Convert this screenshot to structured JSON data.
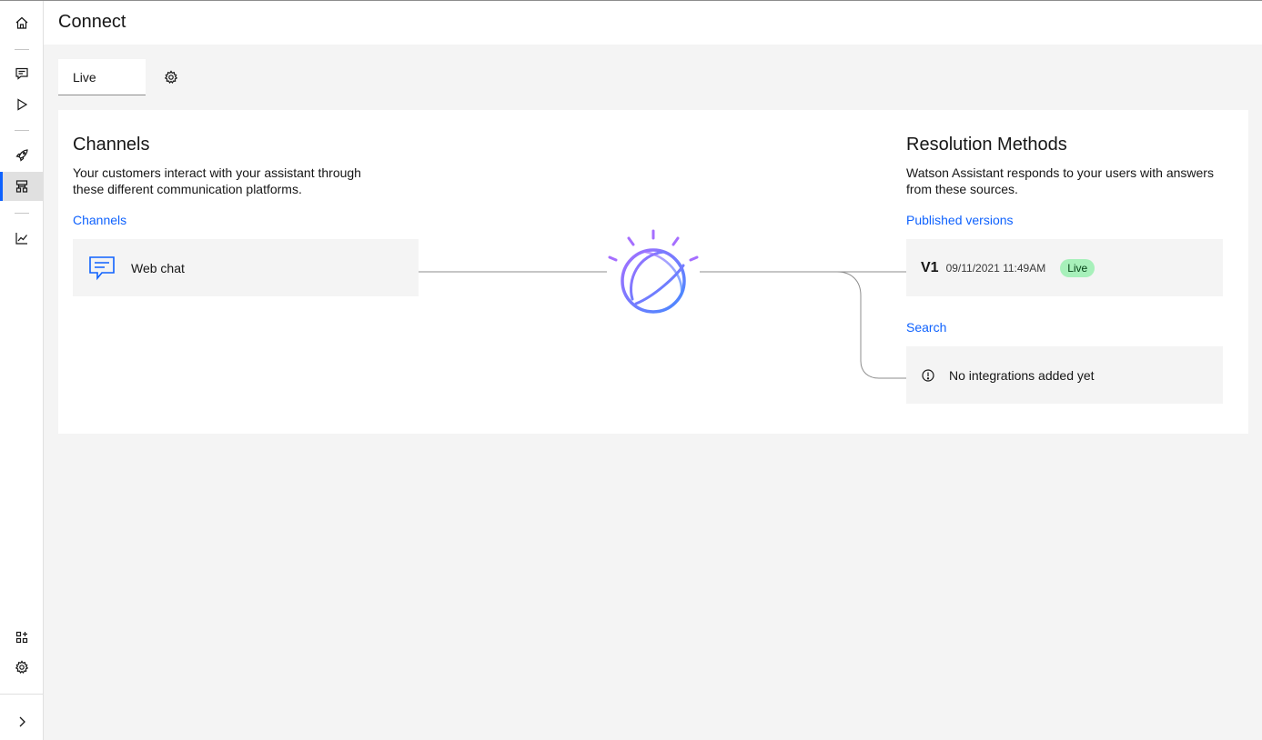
{
  "sidebar": {
    "items": [
      {
        "name": "home-icon"
      },
      {
        "name": "chat-icon"
      },
      {
        "name": "play-icon"
      },
      {
        "name": "rocket-icon"
      },
      {
        "name": "flow-icon",
        "active": true
      },
      {
        "name": "chart-icon"
      },
      {
        "name": "apps-icon"
      },
      {
        "name": "settings-icon"
      },
      {
        "name": "chevron-right-icon"
      }
    ]
  },
  "header": {
    "title": "Connect"
  },
  "environment": {
    "tab_label": "Live"
  },
  "channels": {
    "title": "Channels",
    "description_line1": "Your customers interact with your assistant through",
    "description_line2": "these different communication platforms.",
    "link": "Channels",
    "items": [
      {
        "label": "Web chat",
        "icon": "chat-bubble-icon"
      }
    ]
  },
  "resolution": {
    "title": "Resolution Methods",
    "description_line1": "Watson Assistant responds to your users with answers",
    "description_line2": "from these sources.",
    "published_link": "Published versions",
    "version": {
      "name": "V1",
      "date": "09/11/2021 11:49AM",
      "status": "Live"
    },
    "search_link": "Search",
    "search_empty": "No integrations added yet"
  },
  "colors": {
    "accent": "#0f62fe",
    "live_tag_bg": "#a7f0ba",
    "live_tag_text": "#044317"
  }
}
